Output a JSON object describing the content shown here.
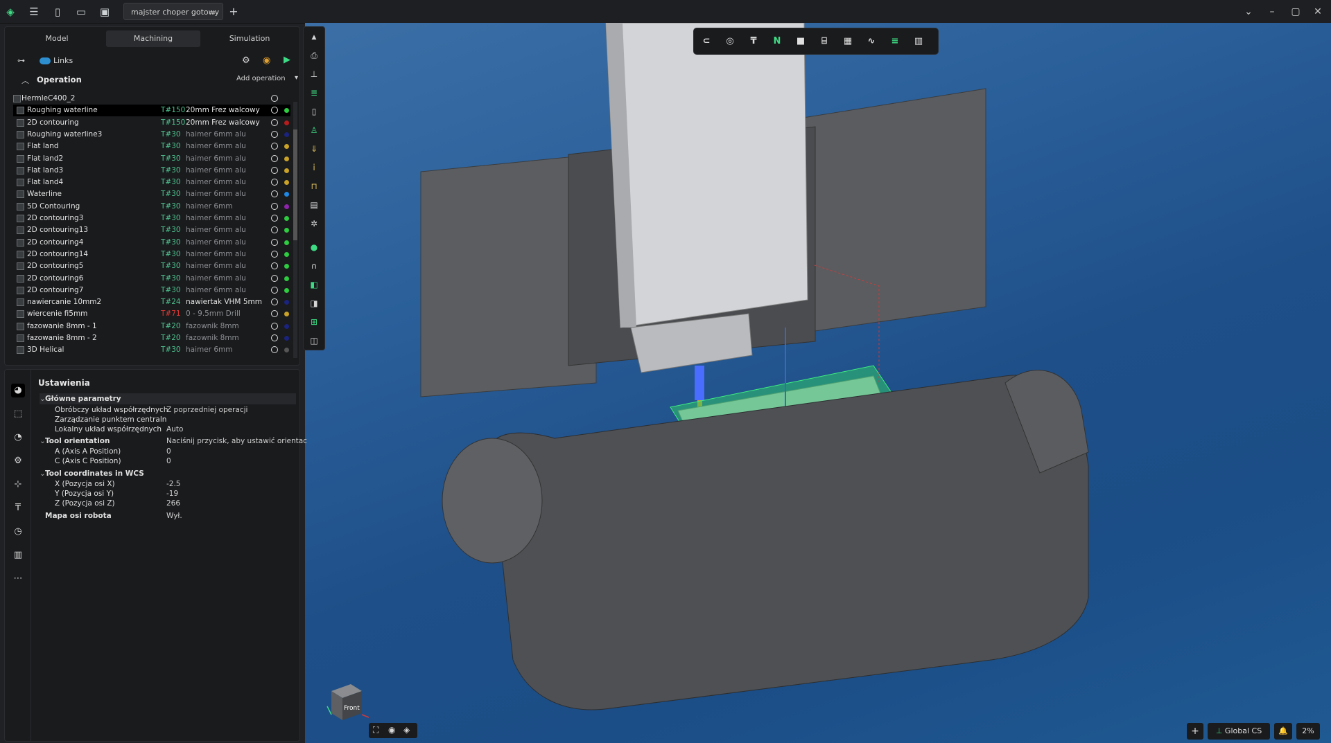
{
  "titlebar": {
    "doc_tab": "majster choper gotowy"
  },
  "tabs": [
    "Model",
    "Machining",
    "Simulation"
  ],
  "links_label": "Links",
  "operation_header": "Operation",
  "add_operation": "Add operation",
  "tree": [
    {
      "name": "HermleC400_2",
      "tnum": "",
      "tname": "",
      "dot": ""
    },
    {
      "name": "Roughing waterline",
      "tnum": "T#150",
      "tname": "20mm Frez walcowy",
      "dot": "#2ecc40"
    },
    {
      "name": "2D contouring",
      "tnum": "T#150",
      "tname": "20mm Frez walcowy",
      "dot": "#b71c1c"
    },
    {
      "name": "Roughing waterline3",
      "tnum": "T#30",
      "tname": "haimer 6mm alu",
      "dot": "#1a237e"
    },
    {
      "name": "Flat land",
      "tnum": "T#30",
      "tname": "haimer 6mm alu",
      "dot": "#c9a227"
    },
    {
      "name": "Flat land2",
      "tnum": "T#30",
      "tname": "haimer 6mm alu",
      "dot": "#c9a227"
    },
    {
      "name": "Flat land3",
      "tnum": "T#30",
      "tname": "haimer 6mm alu",
      "dot": "#c9a227"
    },
    {
      "name": "Flat land4",
      "tnum": "T#30",
      "tname": "haimer 6mm alu",
      "dot": "#c9a227"
    },
    {
      "name": "Waterline",
      "tnum": "T#30",
      "tname": "haimer 6mm alu",
      "dot": "#1e88e5"
    },
    {
      "name": "5D Contouring",
      "tnum": "T#30",
      "tname": "haimer 6mm",
      "dot": "#8e24aa"
    },
    {
      "name": "2D contouring3",
      "tnum": "T#30",
      "tname": "haimer 6mm alu",
      "dot": "#2ecc40"
    },
    {
      "name": "2D contouring13",
      "tnum": "T#30",
      "tname": "haimer 6mm alu",
      "dot": "#2ecc40"
    },
    {
      "name": "2D contouring4",
      "tnum": "T#30",
      "tname": "haimer 6mm alu",
      "dot": "#2ecc40"
    },
    {
      "name": "2D contouring14",
      "tnum": "T#30",
      "tname": "haimer 6mm alu",
      "dot": "#2ecc40"
    },
    {
      "name": "2D contouring5",
      "tnum": "T#30",
      "tname": "haimer 6mm alu",
      "dot": "#2ecc40"
    },
    {
      "name": "2D contouring6",
      "tnum": "T#30",
      "tname": "haimer 6mm alu",
      "dot": "#2ecc40"
    },
    {
      "name": "2D contouring7",
      "tnum": "T#30",
      "tname": "haimer 6mm alu",
      "dot": "#2ecc40"
    },
    {
      "name": "nawiercanie 10mm2",
      "tnum": "T#24",
      "tname": "nawiertak VHM 5mm",
      "dot": "#1a237e"
    },
    {
      "name": "wiercenie fi5mm",
      "tnum": "T#71",
      "tname": "0 - 9.5mm Drill",
      "dot": "#c9a227"
    },
    {
      "name": "fazowanie 8mm - 1",
      "tnum": "T#20",
      "tname": "fazownik 8mm",
      "dot": "#1a237e"
    },
    {
      "name": "fazowanie 8mm - 2",
      "tnum": "T#20",
      "tname": "fazownik 8mm",
      "dot": "#1a237e"
    },
    {
      "name": "3D Helical",
      "tnum": "T#30",
      "tname": "haimer 6mm",
      "dot": "#555555"
    }
  ],
  "settings": {
    "title": "Ustawienia",
    "props": [
      {
        "k": "Główne parametry",
        "v": "",
        "grp": true,
        "indent": 0
      },
      {
        "k": "Obróbczy układ współrzędnych",
        "v": "Z poprzedniej operacji",
        "grp": false,
        "indent": 1
      },
      {
        "k": "Zarządzanie punktem centraln",
        "v": "",
        "grp": false,
        "indent": 1
      },
      {
        "k": "Lokalny układ współrzędnych",
        "v": "Auto",
        "grp": false,
        "indent": 1
      },
      {
        "k": "Tool orientation",
        "v": "Naciśnij przycisk, aby ustawić orientac",
        "grp": true,
        "indent": 0
      },
      {
        "k": "A (Axis A Position)",
        "v": "0",
        "grp": false,
        "indent": 1
      },
      {
        "k": "C (Axis C Position)",
        "v": "0",
        "grp": false,
        "indent": 1
      },
      {
        "k": "Tool coordinates in WCS",
        "v": "",
        "grp": true,
        "indent": 0
      },
      {
        "k": "X (Pozycja osi X)",
        "v": "-2.5",
        "grp": false,
        "indent": 1
      },
      {
        "k": "Y (Pozycja osi Y)",
        "v": "-19",
        "grp": false,
        "indent": 1
      },
      {
        "k": "Z (Pozycja osi Z)",
        "v": "266",
        "grp": false,
        "indent": 1
      },
      {
        "k": "Mapa osi robota",
        "v": "Wył.",
        "grp": true,
        "indent": 0
      }
    ]
  },
  "bottom": {
    "coord_system": "Global CS",
    "zoom": "2%"
  },
  "navcube": {
    "front_label": "Front"
  }
}
